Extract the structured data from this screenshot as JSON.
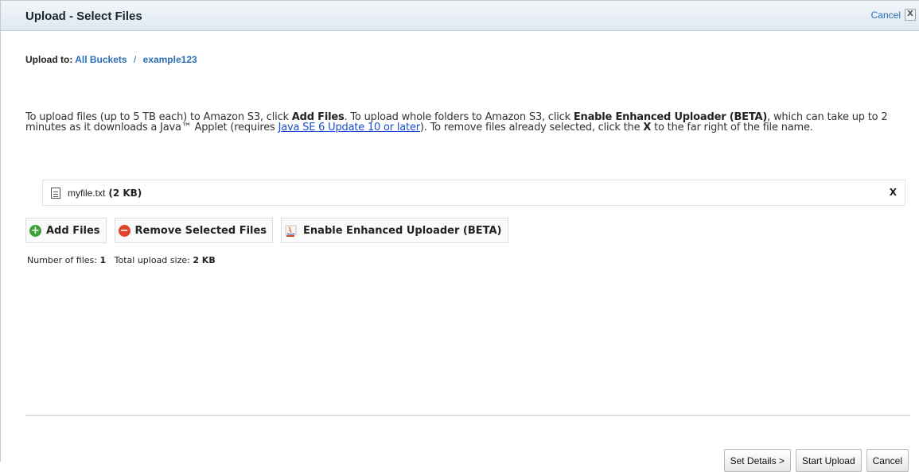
{
  "dialog": {
    "title": "Upload - Select Files",
    "cancel_label": "Cancel",
    "close_glyph": "X"
  },
  "upload_to": {
    "label": "Upload to:",
    "bucket_root": "All Buckets",
    "separator": "/",
    "bucket": "example123"
  },
  "instructions": {
    "part1": "To upload files (up to 5 TB each) to Amazon S3, click ",
    "add_files": "Add Files",
    "part2": ". To upload whole folders to Amazon S3, click ",
    "enhanced": "Enable Enhanced Uploader (BETA)",
    "part3": ", which can take up to 2 minutes as it downloads a Java™ Applet (requires ",
    "java_link": "Java SE 6 Update 10 or later",
    "part4": "). To remove files already selected, click the ",
    "x": "X",
    "part5": " to the far right of the file name."
  },
  "files": [
    {
      "name": "myfile.txt",
      "size": "(2 KB)",
      "remove": "X",
      "icon": "text-file-icon"
    }
  ],
  "toolbar": {
    "add_files": "Add Files",
    "remove_selected": "Remove Selected Files",
    "enable_enhanced": "Enable Enhanced Uploader (BETA)"
  },
  "stats": {
    "files_label": "Number of files:",
    "files_count": "1",
    "size_label": "Total upload size:",
    "size_value": "2 KB"
  },
  "footer": {
    "set_details": "Set Details >",
    "start_upload": "Start Upload",
    "cancel": "Cancel"
  },
  "colors": {
    "link": "#2a6fb8",
    "add_icon": "#3aa23a",
    "remove_icon": "#e0452a"
  }
}
